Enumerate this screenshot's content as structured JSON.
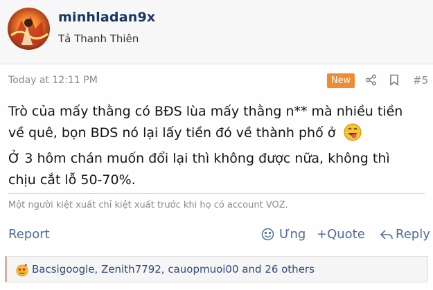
{
  "user": {
    "name": "minhladan9x",
    "title": "Tả Thanh Thiên"
  },
  "meta": {
    "time": "Today at 12:11 PM",
    "badge": "New",
    "post_number": "#5",
    "share_icon": "share-icon",
    "bookmark_icon": "bookmark-icon"
  },
  "post": {
    "line1": "Trò của mấy thằng có BĐS lùa mấy thằng n** mà nhiều tiền",
    "line2": "về quê, bọn BDS nó lại lấy tiền đó về thành phố ở",
    "line3": "Ở 3 hôm chán muốn đổi lại thì không được nữa, không thì",
    "line4": "chịu cắt lỗ 50-70%.",
    "emoji": "grinning-tongue-emoji"
  },
  "signature": "Một người kiệt xuất chỉ kiệt xuất trước khi họ có account VOZ.",
  "actions": {
    "report": "Report",
    "react": "Ưng",
    "quote": "+Quote",
    "reply": "Reply"
  },
  "reactions": {
    "text": "Bacsigoogle, Zenith7792, cauopmuoi00 and 26 others",
    "emoji": "love-emoji"
  }
}
